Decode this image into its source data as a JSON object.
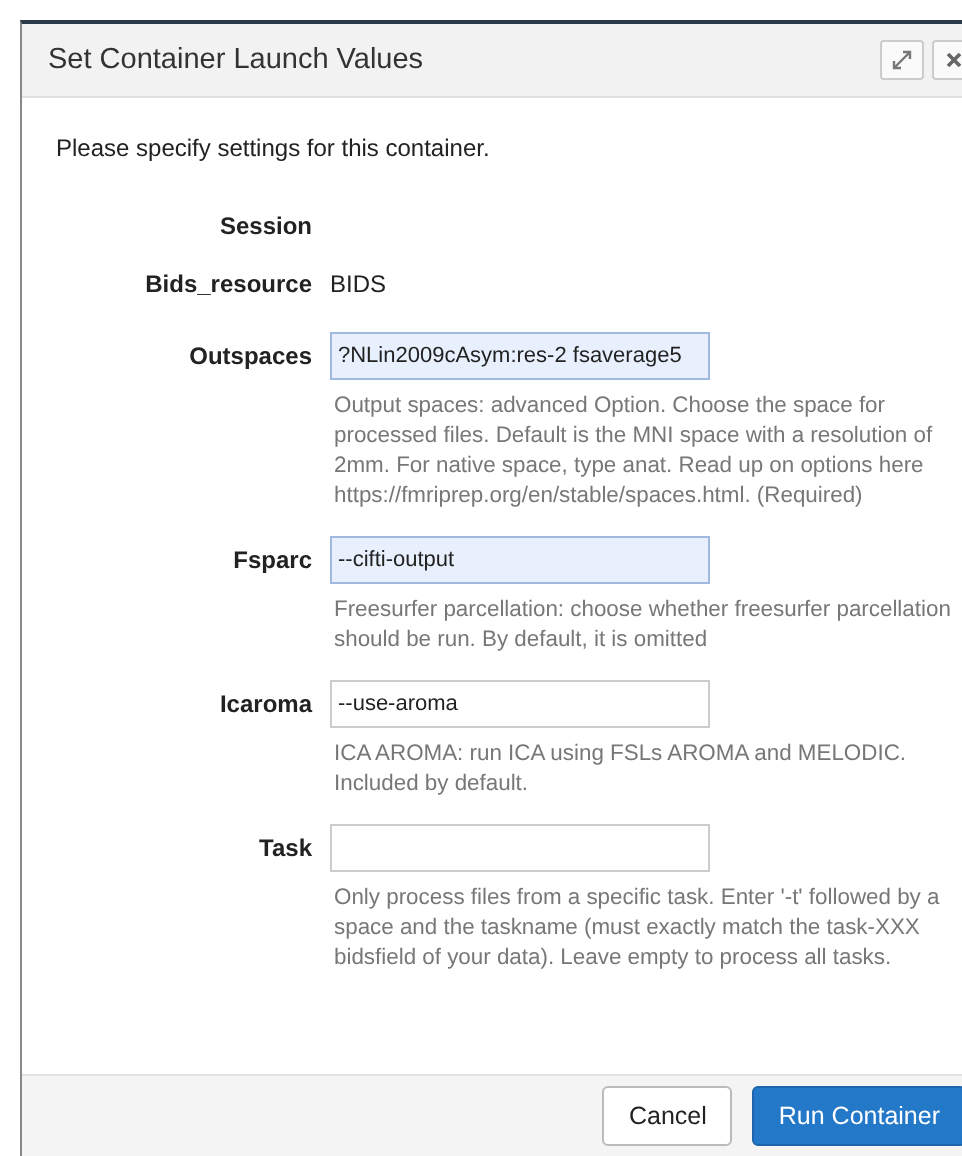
{
  "dialog": {
    "title": "Set Container Launch Values",
    "intro": "Please specify settings for this container.",
    "info_rows": [
      {
        "label": "Session"
      },
      {
        "label": "Bids_resource",
        "value": "BIDS"
      }
    ],
    "fields": [
      {
        "label": "Outspaces",
        "value": "?NLin2009cAsym:res-2 fsaverage5",
        "highlighted": true,
        "help": "Output spaces: advanced Option. Choose the space for processed files. Default is the MNI space with a resolution of 2mm. For native space, type anat. Read up on options here https://fmriprep.org/en/stable/spaces.html. (Required)"
      },
      {
        "label": "Fsparc",
        "value": "--cifti-output",
        "highlighted": true,
        "help": "Freesurfer parcellation: choose whether freesurfer parcellation should be run. By default, it is omitted"
      },
      {
        "label": "Icaroma",
        "value": "--use-aroma",
        "highlighted": false,
        "help": "ICA AROMA: run ICA using FSLs AROMA and MELODIC. Included by default."
      },
      {
        "label": "Task",
        "highlighted": false,
        "help": "Only process files from a specific task. Enter '-t' followed by a space and the taskname (must exactly match the task-XXX bidsfield of your data). Leave empty to process all tasks."
      }
    ],
    "buttons": [
      {
        "label": "Cancel",
        "kind": "default"
      },
      {
        "label": "Run Container",
        "kind": "primary"
      }
    ]
  }
}
